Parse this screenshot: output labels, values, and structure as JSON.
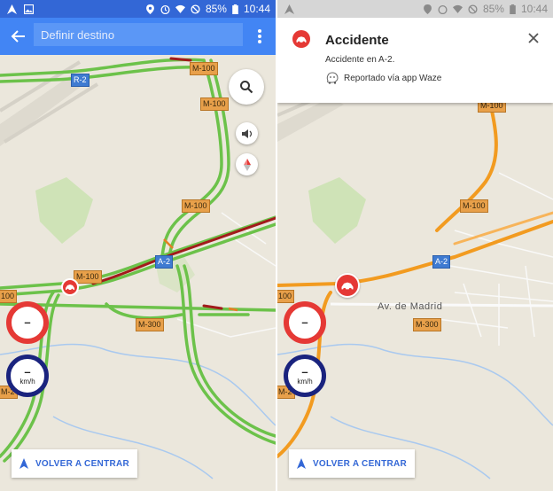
{
  "colors": {
    "map_background": "#ebe7dc",
    "traffic_free": "#6cc24a",
    "traffic_jam": "#a21b1b",
    "route_orange": "#f29b20",
    "header_blue": "#4285f4",
    "status_blue": "#3367d6",
    "incident_red": "#e53935"
  },
  "left": {
    "status_bar": {
      "battery": "85%",
      "time": "10:44",
      "icons": [
        "navigation-arrow-icon",
        "image-icon",
        "location-icon",
        "alarm-icon",
        "wifi-icon",
        "block-icon",
        "battery-icon"
      ]
    },
    "search": {
      "placeholder": "Definir destino"
    },
    "map": {
      "roads": {
        "r2": "R-2",
        "m100_a": "M-100",
        "m100_b": "M-100",
        "m100_c": "M-100",
        "m100_d": "M-100",
        "a2": "A-2",
        "m300": "M-300",
        "edge_100": "100",
        "edge_m2": "M-2"
      }
    },
    "speed_limit": {
      "value": "–"
    },
    "current_speed": {
      "value": "–",
      "unit": "km/h"
    },
    "recenter_label": "VOLVER A CENTRAR"
  },
  "right": {
    "status_bar": {
      "battery": "85%",
      "time": "10:44",
      "icons": [
        "navigation-arrow-icon",
        "location-icon",
        "alarm-icon",
        "wifi-icon",
        "block-icon",
        "battery-icon"
      ]
    },
    "incident": {
      "title": "Accidente",
      "description": "Accidente en A-2.",
      "source": "Reportado vía app Waze"
    },
    "map": {
      "roads": {
        "m100_top": "M-100",
        "m100": "M-100",
        "a2": "A-2",
        "m300": "M-300",
        "edge_100": "100",
        "edge_m2": "M-2"
      },
      "street": "Av. de Madrid"
    },
    "speed_limit": {
      "value": "–"
    },
    "current_speed": {
      "value": "–",
      "unit": "km/h"
    },
    "recenter_label": "VOLVER A CENTRAR"
  }
}
